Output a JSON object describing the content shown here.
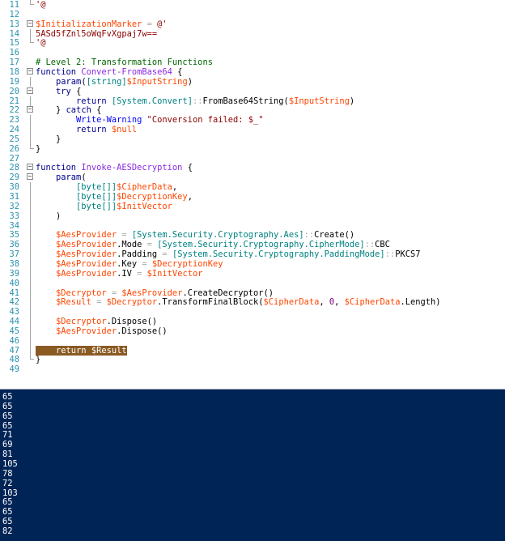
{
  "editor": {
    "lines": [
      {
        "n": "11",
        "fold": "end",
        "tokens": [
          [
            "str",
            "'@"
          ]
        ]
      },
      {
        "n": "12",
        "tokens": []
      },
      {
        "n": "13",
        "fold": "minus",
        "tokens": [
          [
            "var",
            "$InitializationMarker"
          ],
          [
            "op",
            " = "
          ],
          [
            "str",
            "@'"
          ]
        ]
      },
      {
        "n": "14",
        "fold": "guide",
        "tokens": [
          [
            "str",
            "5ASd5fZnl5oWqFvXgpaj7w=="
          ]
        ]
      },
      {
        "n": "15",
        "fold": "end",
        "tokens": [
          [
            "str",
            "'@"
          ]
        ]
      },
      {
        "n": "16",
        "tokens": []
      },
      {
        "n": "17",
        "tokens": [
          [
            "cmt",
            "# Level 2: Transformation Functions"
          ]
        ]
      },
      {
        "n": "18",
        "fold": "minus",
        "tokens": [
          [
            "kw",
            "function"
          ],
          [
            "pl",
            " "
          ],
          [
            "fn",
            "Convert-FromBase64"
          ],
          [
            "pl",
            " {"
          ]
        ]
      },
      {
        "n": "19",
        "fold": "guide",
        "tokens": [
          [
            "pl",
            "    "
          ],
          [
            "kw",
            "param"
          ],
          [
            "pl",
            "("
          ],
          [
            "typ",
            "[string]"
          ],
          [
            "var",
            "$InputString"
          ],
          [
            "pl",
            ")"
          ]
        ]
      },
      {
        "n": "20",
        "fold": "minus",
        "tokens": [
          [
            "pl",
            "    "
          ],
          [
            "kw",
            "try"
          ],
          [
            "pl",
            " {"
          ]
        ]
      },
      {
        "n": "21",
        "fold": "guide",
        "tokens": [
          [
            "pl",
            "        "
          ],
          [
            "kw",
            "return"
          ],
          [
            "pl",
            " "
          ],
          [
            "typ",
            "[System.Convert]"
          ],
          [
            "op",
            "::"
          ],
          [
            "pl",
            "FromBase64String("
          ],
          [
            "var",
            "$InputString"
          ],
          [
            "pl",
            ")"
          ]
        ]
      },
      {
        "n": "22",
        "fold": "minus",
        "tokens": [
          [
            "pl",
            "    } "
          ],
          [
            "kw",
            "catch"
          ],
          [
            "pl",
            " {"
          ]
        ]
      },
      {
        "n": "23",
        "fold": "guide",
        "tokens": [
          [
            "pl",
            "        "
          ],
          [
            "cmd",
            "Write-Warning"
          ],
          [
            "pl",
            " "
          ],
          [
            "str",
            "\"Conversion failed: $_\""
          ]
        ]
      },
      {
        "n": "24",
        "fold": "guide",
        "tokens": [
          [
            "pl",
            "        "
          ],
          [
            "kw",
            "return"
          ],
          [
            "pl",
            " "
          ],
          [
            "var",
            "$null"
          ]
        ]
      },
      {
        "n": "25",
        "fold": "guide",
        "tokens": [
          [
            "pl",
            "    }"
          ]
        ]
      },
      {
        "n": "26",
        "fold": "end",
        "tokens": [
          [
            "pl",
            "}"
          ]
        ]
      },
      {
        "n": "27",
        "tokens": []
      },
      {
        "n": "28",
        "fold": "minus",
        "tokens": [
          [
            "kw",
            "function"
          ],
          [
            "pl",
            " "
          ],
          [
            "fn",
            "Invoke-AESDecryption"
          ],
          [
            "pl",
            " {"
          ]
        ]
      },
      {
        "n": "29",
        "fold": "minus",
        "tokens": [
          [
            "pl",
            "    "
          ],
          [
            "kw",
            "param"
          ],
          [
            "pl",
            "("
          ]
        ]
      },
      {
        "n": "30",
        "fold": "guide",
        "tokens": [
          [
            "pl",
            "        "
          ],
          [
            "typ",
            "[byte[]]"
          ],
          [
            "var",
            "$CipherData"
          ],
          [
            "pl",
            ","
          ]
        ]
      },
      {
        "n": "31",
        "fold": "guide",
        "tokens": [
          [
            "pl",
            "        "
          ],
          [
            "typ",
            "[byte[]]"
          ],
          [
            "var",
            "$DecryptionKey"
          ],
          [
            "pl",
            ","
          ]
        ]
      },
      {
        "n": "32",
        "fold": "guide",
        "tokens": [
          [
            "pl",
            "        "
          ],
          [
            "typ",
            "[byte[]]"
          ],
          [
            "var",
            "$InitVector"
          ]
        ]
      },
      {
        "n": "33",
        "fold": "guide",
        "tokens": [
          [
            "pl",
            "    )"
          ]
        ]
      },
      {
        "n": "34",
        "fold": "guide",
        "tokens": []
      },
      {
        "n": "35",
        "fold": "guide",
        "tokens": [
          [
            "pl",
            "    "
          ],
          [
            "var",
            "$AesProvider"
          ],
          [
            "op",
            " = "
          ],
          [
            "typ",
            "[System.Security.Cryptography.Aes]"
          ],
          [
            "op",
            "::"
          ],
          [
            "pl",
            "Create()"
          ]
        ]
      },
      {
        "n": "36",
        "fold": "guide",
        "tokens": [
          [
            "pl",
            "    "
          ],
          [
            "var",
            "$AesProvider"
          ],
          [
            "pl",
            ".Mode "
          ],
          [
            "op",
            "= "
          ],
          [
            "typ",
            "[System.Security.Cryptography.CipherMode]"
          ],
          [
            "op",
            "::"
          ],
          [
            "pl",
            "CBC"
          ]
        ]
      },
      {
        "n": "37",
        "fold": "guide",
        "tokens": [
          [
            "pl",
            "    "
          ],
          [
            "var",
            "$AesProvider"
          ],
          [
            "pl",
            ".Padding "
          ],
          [
            "op",
            "= "
          ],
          [
            "typ",
            "[System.Security.Cryptography.PaddingMode]"
          ],
          [
            "op",
            "::"
          ],
          [
            "pl",
            "PKCS7"
          ]
        ]
      },
      {
        "n": "38",
        "fold": "guide",
        "tokens": [
          [
            "pl",
            "    "
          ],
          [
            "var",
            "$AesProvider"
          ],
          [
            "pl",
            ".Key "
          ],
          [
            "op",
            "= "
          ],
          [
            "var",
            "$DecryptionKey"
          ]
        ]
      },
      {
        "n": "39",
        "fold": "guide",
        "tokens": [
          [
            "pl",
            "    "
          ],
          [
            "var",
            "$AesProvider"
          ],
          [
            "pl",
            ".IV "
          ],
          [
            "op",
            "= "
          ],
          [
            "var",
            "$InitVector"
          ]
        ]
      },
      {
        "n": "40",
        "fold": "guide",
        "tokens": []
      },
      {
        "n": "41",
        "fold": "guide",
        "tokens": [
          [
            "pl",
            "    "
          ],
          [
            "var",
            "$Decryptor"
          ],
          [
            "op",
            " = "
          ],
          [
            "var",
            "$AesProvider"
          ],
          [
            "pl",
            ".CreateDecryptor()"
          ]
        ]
      },
      {
        "n": "42",
        "fold": "guide",
        "tokens": [
          [
            "pl",
            "    "
          ],
          [
            "var",
            "$Result"
          ],
          [
            "op",
            " = "
          ],
          [
            "var",
            "$Decryptor"
          ],
          [
            "pl",
            ".TransformFinalBlock("
          ],
          [
            "var",
            "$CipherData"
          ],
          [
            "pl",
            ", "
          ],
          [
            "num",
            "0"
          ],
          [
            "pl",
            ", "
          ],
          [
            "var",
            "$CipherData"
          ],
          [
            "pl",
            ".Length)"
          ]
        ]
      },
      {
        "n": "43",
        "fold": "guide",
        "tokens": []
      },
      {
        "n": "44",
        "fold": "guide",
        "tokens": [
          [
            "pl",
            "    "
          ],
          [
            "var",
            "$Decryptor"
          ],
          [
            "pl",
            ".Dispose()"
          ]
        ]
      },
      {
        "n": "45",
        "fold": "guide",
        "tokens": [
          [
            "pl",
            "    "
          ],
          [
            "var",
            "$AesProvider"
          ],
          [
            "pl",
            ".Dispose()"
          ]
        ]
      },
      {
        "n": "46",
        "fold": "guide",
        "tokens": []
      },
      {
        "n": "47",
        "fold": "guide",
        "highlight": true,
        "tokens": [
          [
            "hl",
            "    return $Result"
          ]
        ]
      },
      {
        "n": "48",
        "fold": "end",
        "tokens": [
          [
            "pl",
            "}"
          ]
        ]
      },
      {
        "n": "49",
        "tokens": []
      }
    ]
  },
  "console": {
    "output": [
      "65",
      "65",
      "65",
      "65",
      "71",
      "69",
      "81",
      "105",
      "78",
      "72",
      "103",
      "65",
      "65",
      "65",
      "82"
    ]
  },
  "colors": {
    "console_bg": "#012456",
    "highlight_bg": "#8a5a23",
    "line_number": "#2b91af"
  }
}
